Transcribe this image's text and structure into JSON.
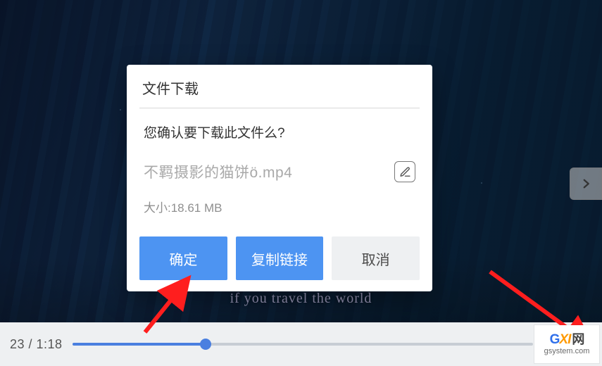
{
  "dialog": {
    "title": "文件下载",
    "confirm_text": "您确认要下载此文件么?",
    "filename": "不羁摄影的猫饼ö.mp4",
    "size_label": "大小:18.61 MB",
    "buttons": {
      "confirm": "确定",
      "copy_link": "复制链接",
      "cancel": "取消"
    }
  },
  "player": {
    "time_label": "23 / 1:18",
    "progress_percent": 29,
    "caption_overlay": "if you travel the world"
  },
  "watermark": {
    "brand_g": "G",
    "brand_xi": "XI",
    "brand_net": "网",
    "sub": "gsystem.com"
  },
  "colors": {
    "primary": "#4d94f2",
    "arrow": "#ff1e1e"
  }
}
